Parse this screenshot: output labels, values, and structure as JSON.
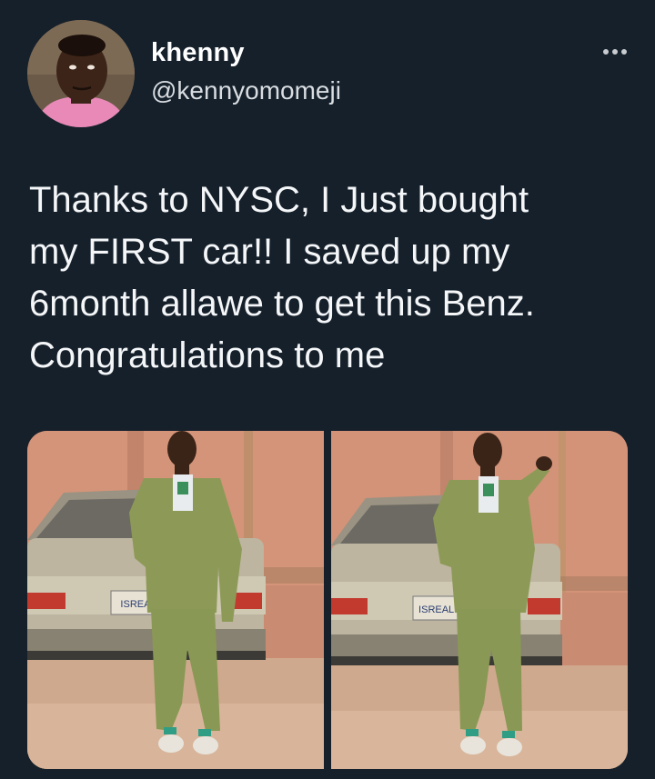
{
  "author": {
    "display_name": "khenny",
    "handle": "@kennyomomeji",
    "avatar_icon": "avatar-photo"
  },
  "more_icon": "more-horizontal-icon",
  "tweet": {
    "text": "Thanks to NYSC, I Just bought\nmy FIRST car!! I saved up my\n6month allawe to get this Benz.\nCongratulations to me"
  },
  "media": [
    {
      "plate": "ISREAL",
      "pose": "hands-in-pockets"
    },
    {
      "plate": "ISREAL 1",
      "pose": "hand-raised"
    }
  ],
  "colors": {
    "background": "#15202b",
    "text": "#ffffff",
    "secondary": "#d9dde1"
  }
}
